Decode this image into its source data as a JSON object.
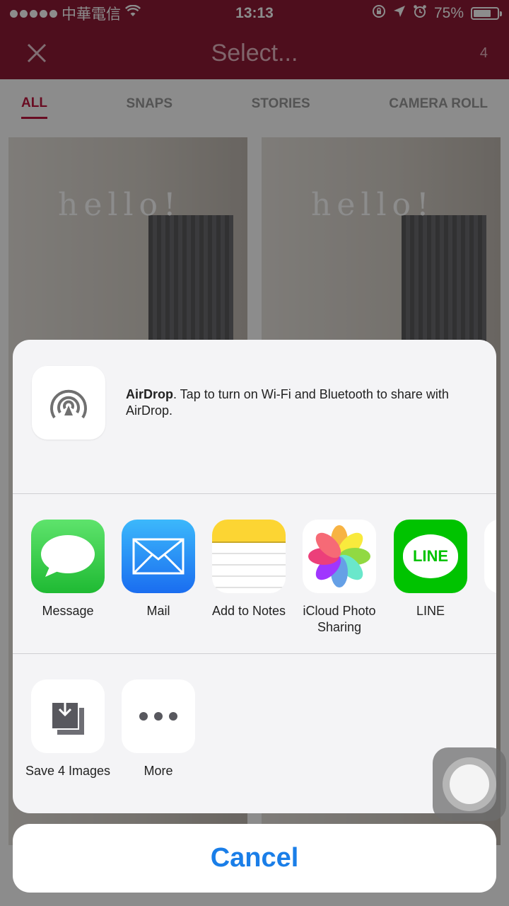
{
  "status_bar": {
    "carrier": "中華電信",
    "time": "13:13",
    "battery": "75%",
    "battery_level": 0.75,
    "icons": [
      "signal-dots",
      "wifi-icon",
      "rotation-lock-icon",
      "location-icon",
      "alarm-icon",
      "battery-icon"
    ]
  },
  "header": {
    "close_icon": "close-icon",
    "title": "Select...",
    "count": "4"
  },
  "tabs": [
    {
      "label": "ALL",
      "active": true
    },
    {
      "label": "SNAPS",
      "active": false
    },
    {
      "label": "STORIES",
      "active": false
    },
    {
      "label": "CAMERA ROLL",
      "active": false
    }
  ],
  "thumbnails": {
    "caption": "hello!"
  },
  "share_sheet": {
    "airdrop": {
      "title": "AirDrop",
      "message": ". Tap to turn on Wi-Fi and Bluetooth to share with AirDrop."
    },
    "apps": [
      {
        "label": "Message",
        "icon": "message-icon"
      },
      {
        "label": "Mail",
        "icon": "mail-icon"
      },
      {
        "label": "Add to Notes",
        "icon": "notes-icon"
      },
      {
        "label": "iCloud Photo Sharing",
        "icon": "photos-icon"
      },
      {
        "label": "LINE",
        "icon": "line-icon",
        "icon_text": "LINE"
      }
    ],
    "actions": [
      {
        "label": "Save 4 Images",
        "icon": "save-images-icon"
      },
      {
        "label": "More",
        "icon": "more-icon"
      }
    ],
    "cancel_label": "Cancel"
  },
  "colors": {
    "brand": "#8e1a36",
    "tab_active": "#c0163f",
    "cancel_text": "#1a7ee8"
  }
}
